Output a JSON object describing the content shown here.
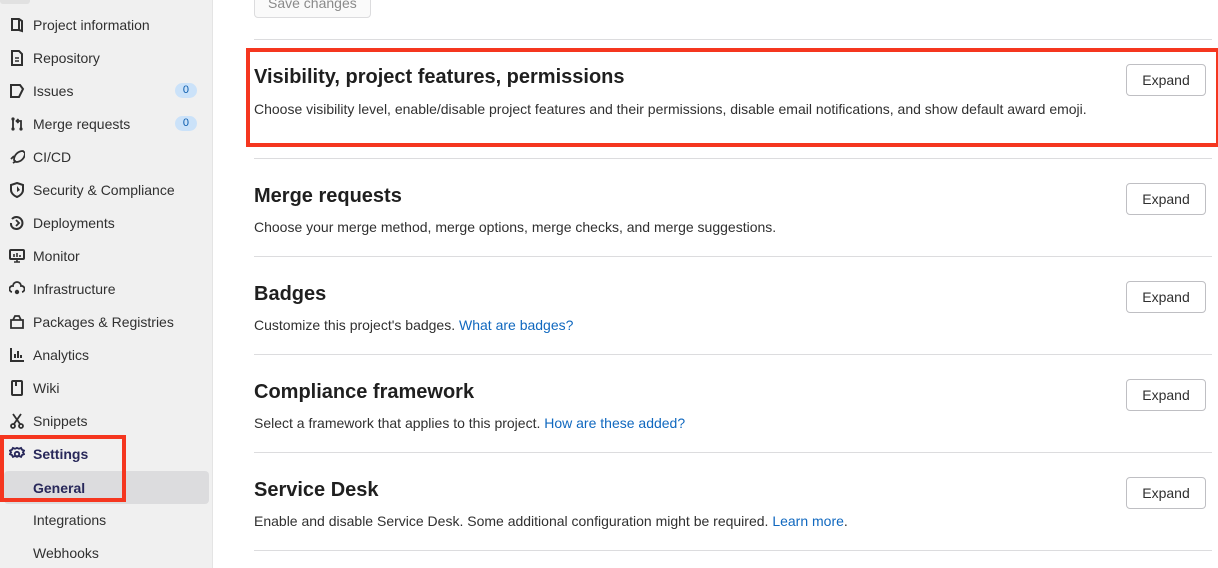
{
  "sidebar": {
    "items": [
      {
        "label": "Project information",
        "icon": "project-icon"
      },
      {
        "label": "Repository",
        "icon": "document-icon"
      },
      {
        "label": "Issues",
        "icon": "issues-icon",
        "badge": "0"
      },
      {
        "label": "Merge requests",
        "icon": "merge-request-icon",
        "badge": "0"
      },
      {
        "label": "CI/CD",
        "icon": "rocket-icon"
      },
      {
        "label": "Security & Compliance",
        "icon": "shield-icon"
      },
      {
        "label": "Deployments",
        "icon": "deployments-icon"
      },
      {
        "label": "Monitor",
        "icon": "monitor-icon"
      },
      {
        "label": "Infrastructure",
        "icon": "cloud-gear-icon"
      },
      {
        "label": "Packages & Registries",
        "icon": "package-icon"
      },
      {
        "label": "Analytics",
        "icon": "chart-icon"
      },
      {
        "label": "Wiki",
        "icon": "book-icon"
      },
      {
        "label": "Snippets",
        "icon": "scissors-icon"
      },
      {
        "label": "Settings",
        "icon": "gear-icon",
        "active": true
      }
    ],
    "settings_subitems": [
      {
        "label": "General",
        "active": true
      },
      {
        "label": "Integrations"
      },
      {
        "label": "Webhooks"
      }
    ]
  },
  "main": {
    "save_button": "Save changes",
    "expand_label": "Expand",
    "sections": [
      {
        "title": "Visibility, project features, permissions",
        "description": "Choose visibility level, enable/disable project features and their permissions, disable email notifications, and show default award emoji.",
        "link": null
      },
      {
        "title": "Merge requests",
        "description": "Choose your merge method, merge options, merge checks, and merge suggestions.",
        "link": null
      },
      {
        "title": "Badges",
        "description": "Customize this project's badges.",
        "link": "What are badges?"
      },
      {
        "title": "Compliance framework",
        "description": "Select a framework that applies to this project.",
        "link": "How are these added?"
      },
      {
        "title": "Service Desk",
        "description": "Enable and disable Service Desk. Some additional configuration might be required.",
        "link": "Learn more",
        "suffix": "."
      }
    ]
  },
  "colors": {
    "highlight": "#f5361f",
    "link": "#1068bf",
    "badge_bg": "#cbe2f9",
    "active_text": "#28285a"
  }
}
